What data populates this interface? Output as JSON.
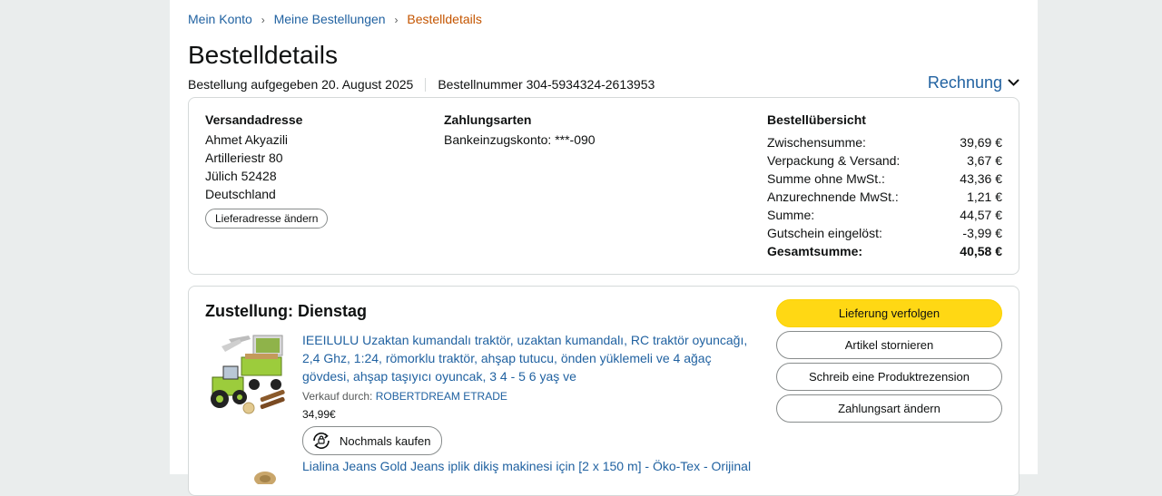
{
  "breadcrumb": {
    "items": [
      "Mein Konto",
      "Meine Bestellungen"
    ],
    "current": "Bestelldetails",
    "separator": "›"
  },
  "title": "Bestelldetails",
  "meta": {
    "ordered": "Bestellung aufgegeben 20. August 2025",
    "order_number": "Bestellnummer 304-5934324-2613953"
  },
  "invoice_label": "Rechnung",
  "shipping": {
    "heading": "Versandadresse",
    "lines": [
      "Ahmet Akyazili",
      "Artilleriestr 80",
      "Jülich 52428",
      "Deutschland"
    ],
    "change_label": "Lieferadresse ändern"
  },
  "payment": {
    "heading": "Zahlungsarten",
    "method": "Bankeinzugskonto: ***-090"
  },
  "summary": {
    "heading": "Bestellübersicht",
    "rows": [
      {
        "label": "Zwischensumme:",
        "value": "39,69 €"
      },
      {
        "label": "Verpackung & Versand:",
        "value": "3,67 €"
      },
      {
        "label": "Summe ohne MwSt.:",
        "value": "43,36 €"
      },
      {
        "label": "Anzurechnende MwSt.:",
        "value": "1,21 €"
      },
      {
        "label": "Summe:",
        "value": "44,57 €"
      },
      {
        "label": "Gutschein eingelöst:",
        "value": "-3,99 €"
      }
    ],
    "total": {
      "label": "Gesamtsumme:",
      "value": "40,58 €"
    }
  },
  "delivery": {
    "heading": "Zustellung: Dienstag",
    "item1": {
      "title": "IEEILULU Uzaktan kumandalı traktör, uzaktan kumandalı, RC traktör oyuncağı, 2,4 Ghz, 1:24, römorklu traktör, ahşap tutucu, önden yüklemeli ve 4 ağaç gövdesi, ahşap taşıyıcı oyuncak, 3 4 - 5 6 yaş ve",
      "seller_prefix": "Verkauf durch:",
      "seller": "ROBERTDREAM ETRADE",
      "price": "34,99€",
      "buy_again": "Nochmals kaufen"
    },
    "item2": {
      "title": "Lialina Jeans Gold Jeans iplik dikiş makinesi için [2 x 150 m] - Öko-Tex - Orijinal"
    },
    "actions": [
      "Lieferung verfolgen",
      "Artikel stornieren",
      "Schreib eine Produktrezension",
      "Zahlungsart ändern"
    ]
  },
  "colors": {
    "link": "#2162a1",
    "accent_orange": "#c45500",
    "primary_button": "#ffd814",
    "background": "#eaeded"
  }
}
